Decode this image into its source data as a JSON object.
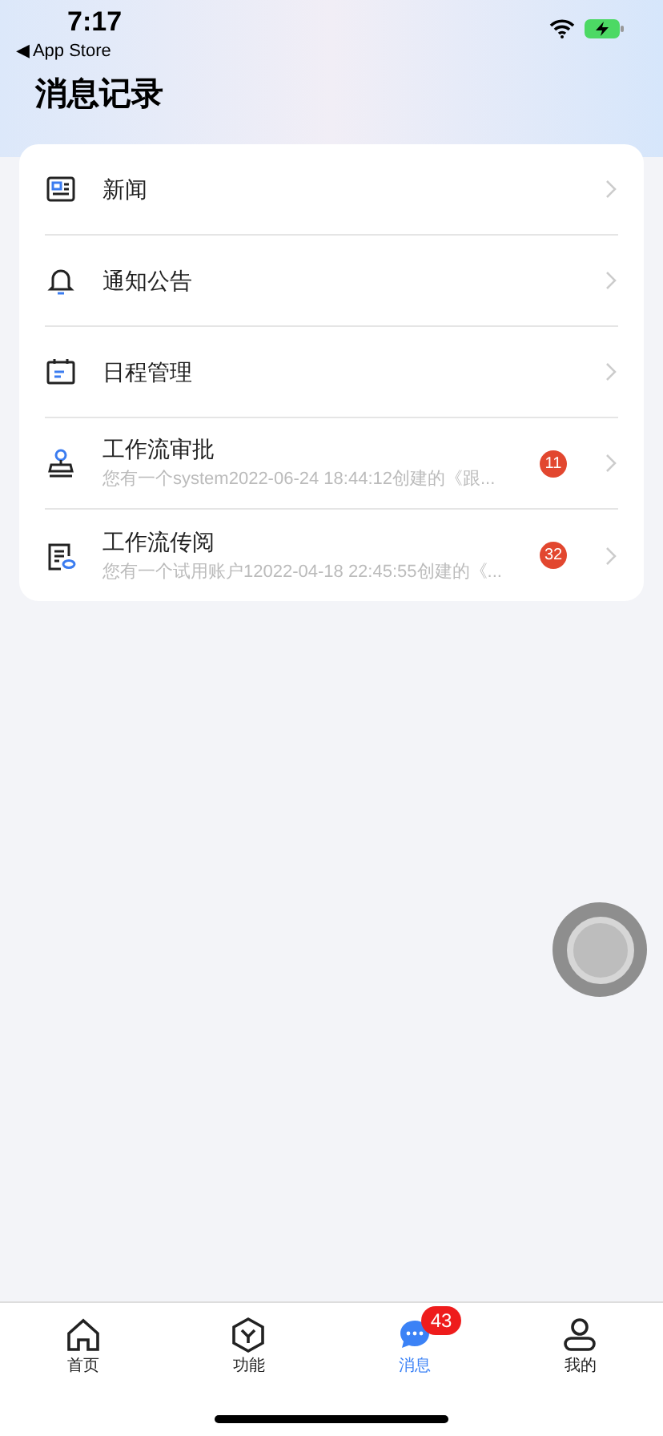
{
  "status_bar": {
    "time": "7:17",
    "back_label": "◀ App Store"
  },
  "title": "消息记录",
  "items": [
    {
      "kind": "news",
      "title": "新闻"
    },
    {
      "kind": "bell",
      "title": "通知公告"
    },
    {
      "kind": "calendar",
      "title": "日程管理"
    },
    {
      "kind": "stamp",
      "title": "工作流审批",
      "subtitle": "您有一个system2022-06-24 18:44:12创建的《跟...",
      "badge": "11"
    },
    {
      "kind": "doc",
      "title": "工作流传阅",
      "subtitle": "您有一个试用账户12022-04-18 22:45:55创建的《...",
      "badge": "32"
    }
  ],
  "tabs": [
    {
      "kind": "home",
      "label": "首页",
      "selected": false
    },
    {
      "kind": "cube",
      "label": "功能",
      "selected": false
    },
    {
      "kind": "chat",
      "label": "消息",
      "selected": true,
      "badge": "43"
    },
    {
      "kind": "user",
      "label": "我的",
      "selected": false
    }
  ]
}
